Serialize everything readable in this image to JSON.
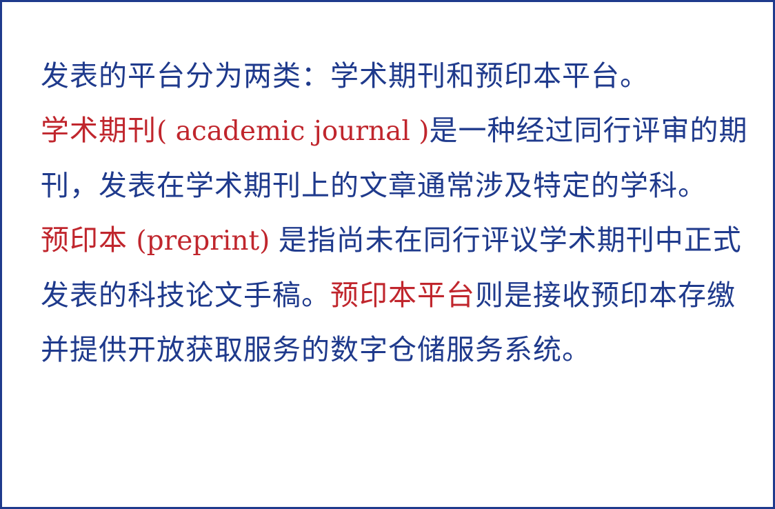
{
  "colors": {
    "border": "#1f3a8c",
    "body_text": "#1f3a8c",
    "highlight_text": "#c0262d",
    "background": "#ffffff"
  },
  "document": {
    "paragraph_1": {
      "text": "发表的平台分为两类：学术期刊和预印本平台。"
    },
    "paragraph_2": {
      "term": "学术期刊",
      "term_en": "( academic journal )",
      "text": "是一种经过同行评审的期刊，发表在学术期刊上的文章通常涉及特定的学科。"
    },
    "paragraph_3": {
      "term": "预印本",
      "term_en": " (preprint) ",
      "text_1": "是指尚未在同行评议学术期刊中正式发表的科技论文手稿。",
      "term_2": "预印本平台",
      "text_2": "则是接收预印本存缴并提供开放获取服务的数字仓储服务系统。"
    }
  }
}
